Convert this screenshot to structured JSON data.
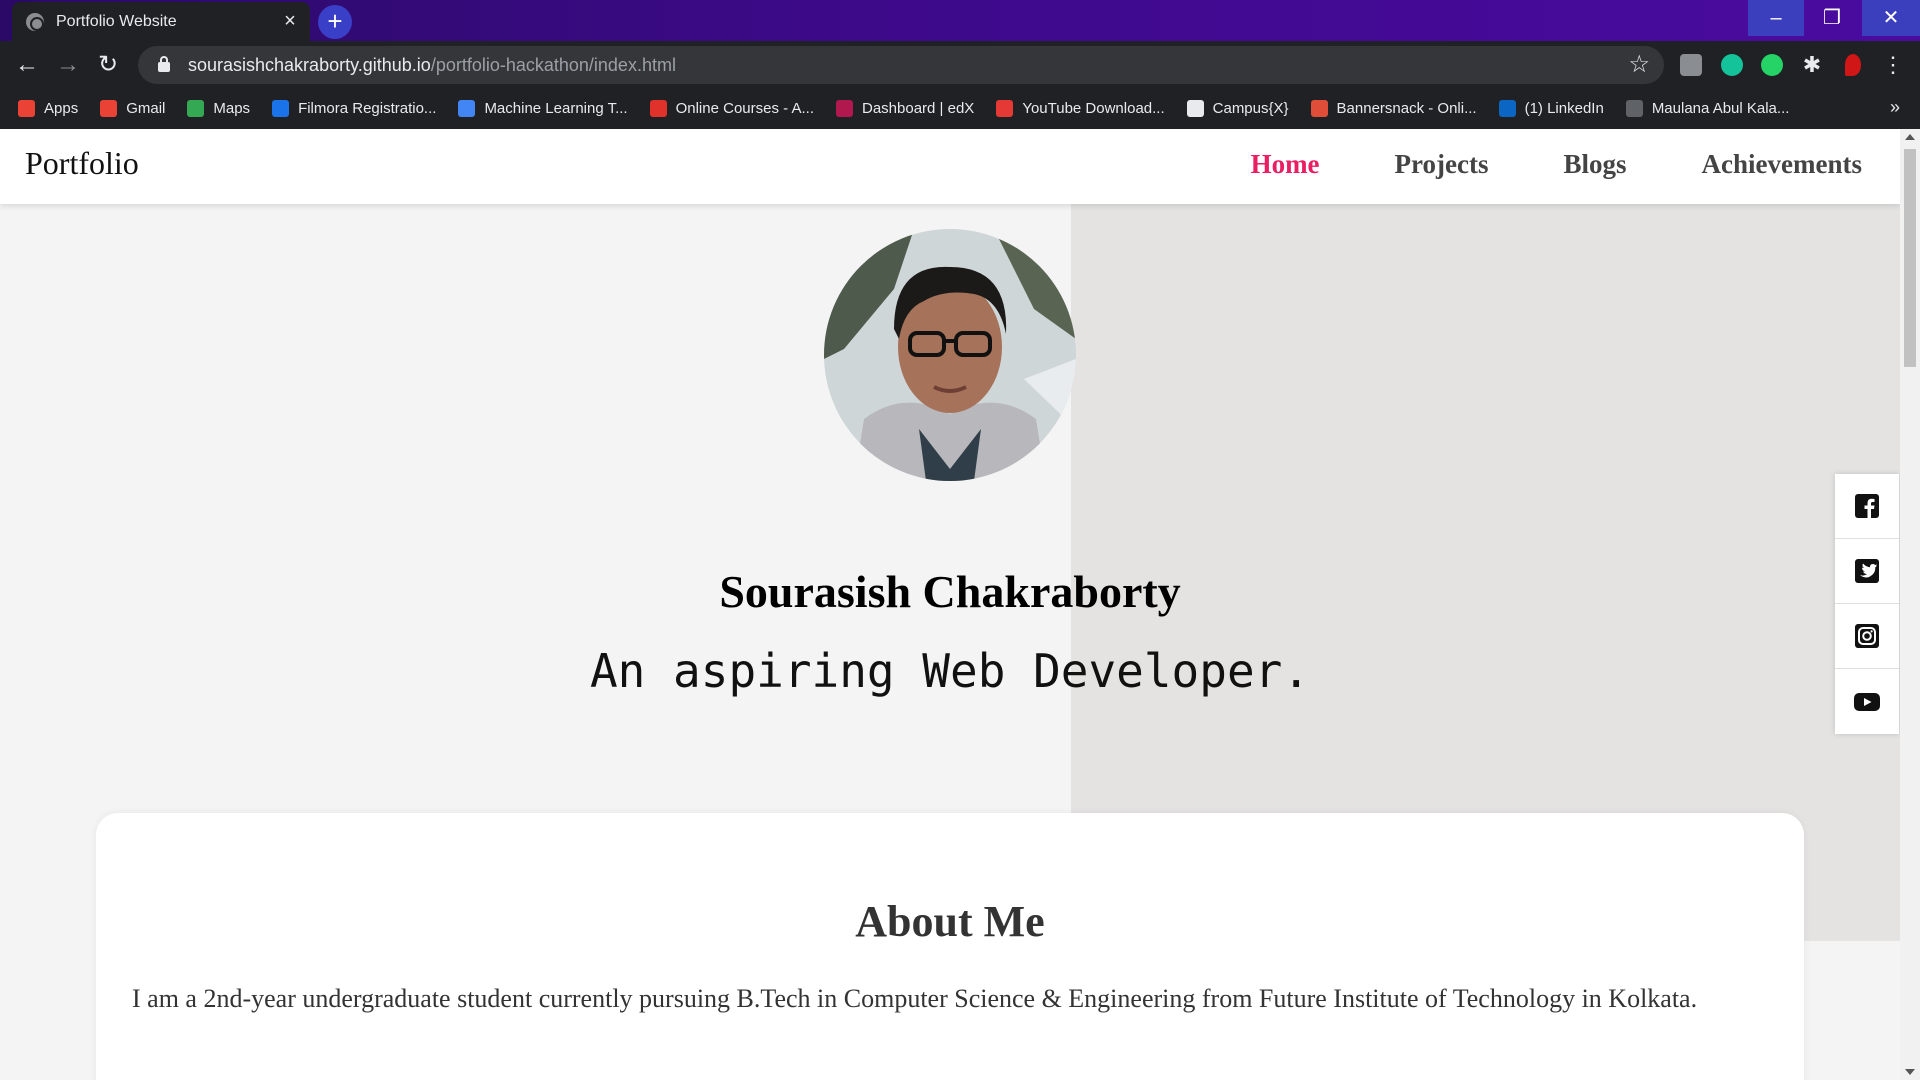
{
  "browser": {
    "tab_title": "Portfolio Website",
    "url_host": "sourasishchakraborty.github.io",
    "url_path": "/portfolio-hackathon/index.html",
    "theme_colors": {
      "titlebar": "#3d0a8a",
      "toolbar": "#202124"
    },
    "bookmarks": [
      {
        "label": "Apps",
        "icon": "apps-grid-icon",
        "color": "#ea4335"
      },
      {
        "label": "Gmail",
        "icon": "gmail-icon",
        "color": "#ea4335"
      },
      {
        "label": "Maps",
        "icon": "maps-pin-icon",
        "color": "#34a853"
      },
      {
        "label": "Filmora Registratio...",
        "icon": "filmora-icon",
        "color": "#1a73e8"
      },
      {
        "label": "Machine Learning T...",
        "icon": "machine-learning-icon",
        "color": "#4285f4"
      },
      {
        "label": "Online Courses - A...",
        "icon": "udemy-icon",
        "color": "#e0312b"
      },
      {
        "label": "Dashboard | edX",
        "icon": "edx-icon",
        "color": "#b1184e"
      },
      {
        "label": "YouTube Download...",
        "icon": "download-icon",
        "color": "#e53935"
      },
      {
        "label": "Campus{X}",
        "icon": "campusx-icon",
        "color": "#e8eaed"
      },
      {
        "label": "Bannersnack - Onli...",
        "icon": "bannersnack-icon",
        "color": "#e04e39"
      },
      {
        "label": "(1) LinkedIn",
        "icon": "linkedin-icon",
        "color": "#0a66c2"
      },
      {
        "label": "Maulana Abul Kala...",
        "icon": "graduation-cap-icon",
        "color": "#5f6368"
      }
    ]
  },
  "site": {
    "brand": "Portfolio",
    "nav": [
      {
        "label": "Home",
        "active": true
      },
      {
        "label": "Projects",
        "active": false
      },
      {
        "label": "Blogs",
        "active": false
      },
      {
        "label": "Achievements",
        "active": false
      }
    ],
    "accent_color": "#e91e63",
    "hero": {
      "name": "Sourasish Chakraborty",
      "tagline": "An aspiring Web Developer."
    },
    "social": [
      "facebook-icon",
      "twitter-icon",
      "instagram-icon",
      "youtube-icon"
    ],
    "about": {
      "heading": "About Me",
      "text": "I am a 2nd-year undergraduate student currently pursuing B.Tech in Computer Science & Engineering from Future Institute of Technology in Kolkata."
    }
  }
}
